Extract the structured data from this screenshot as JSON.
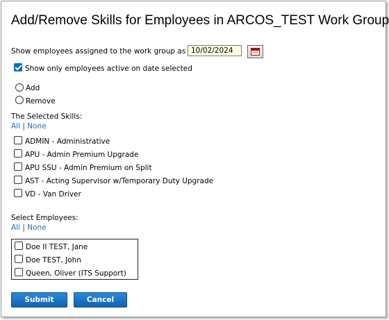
{
  "title": "Add/Remove Skills for Employees in ARCOS_TEST Work Group",
  "date_filter": {
    "label": "Show employees assigned to the work group as of:",
    "value": "10/02/2024"
  },
  "active_only": {
    "label": "Show only employees active on date selected",
    "checked": true
  },
  "mode": {
    "options": [
      "Add",
      "Remove"
    ]
  },
  "skills": {
    "heading": "The Selected Skills:",
    "all_label": "All",
    "separator": "|",
    "none_label": "None",
    "items": [
      "ADMIN - Administrative",
      "APU - Admin Premium Upgrade",
      "APU SSU - Admin Premium on Split",
      "AST - Acting Supervisor w/Temporary Duty Upgrade",
      "VD - Van Driver"
    ]
  },
  "employees": {
    "heading": "Select Employees:",
    "all_label": "All",
    "separator": "|",
    "none_label": "None",
    "items": [
      "Doe II TEST, Jane",
      "Doe TEST, John",
      "Queen, Oliver (ITS Support)"
    ]
  },
  "buttons": {
    "submit": "Submit",
    "cancel": "Cancel"
  },
  "colors": {
    "button": "#1670c4",
    "link": "#1a6fc0",
    "date_field_bg": "#ffffe0"
  }
}
